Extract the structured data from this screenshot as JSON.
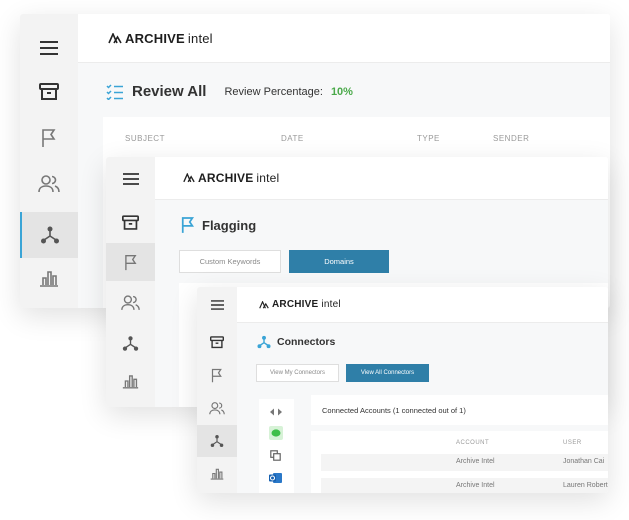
{
  "brand": {
    "name_bold": "ARCHIVE",
    "name_light": "intel"
  },
  "colors": {
    "accent": "#3aa4d6",
    "green": "#4aa94a",
    "primary_button": "#2f7fa8"
  },
  "win1": {
    "nav_icons": [
      "menu-icon",
      "archive-box-icon",
      "flag-icon",
      "users-icon",
      "connectors-icon",
      "bar-chart-icon"
    ],
    "title": "Review All",
    "review_label": "Review Percentage:",
    "review_value": "10%",
    "columns": [
      "SUBJECT",
      "DATE",
      "TYPE",
      "SENDER"
    ]
  },
  "win2": {
    "title": "Flagging",
    "tab_custom": "Custom Keywords",
    "tab_domains": "Domains"
  },
  "win3": {
    "title": "Connectors",
    "btn_my": "View My Connectors",
    "btn_all": "View All Connectors",
    "connected_text": "Connected Accounts (1 connected out of 1)",
    "columns": [
      "ACCOUNT",
      "USER"
    ],
    "rows": [
      {
        "account": "Archive Intel",
        "user": "Jonathan Cai"
      },
      {
        "account": "Archive Intel",
        "user": "Lauren Robert"
      }
    ]
  }
}
